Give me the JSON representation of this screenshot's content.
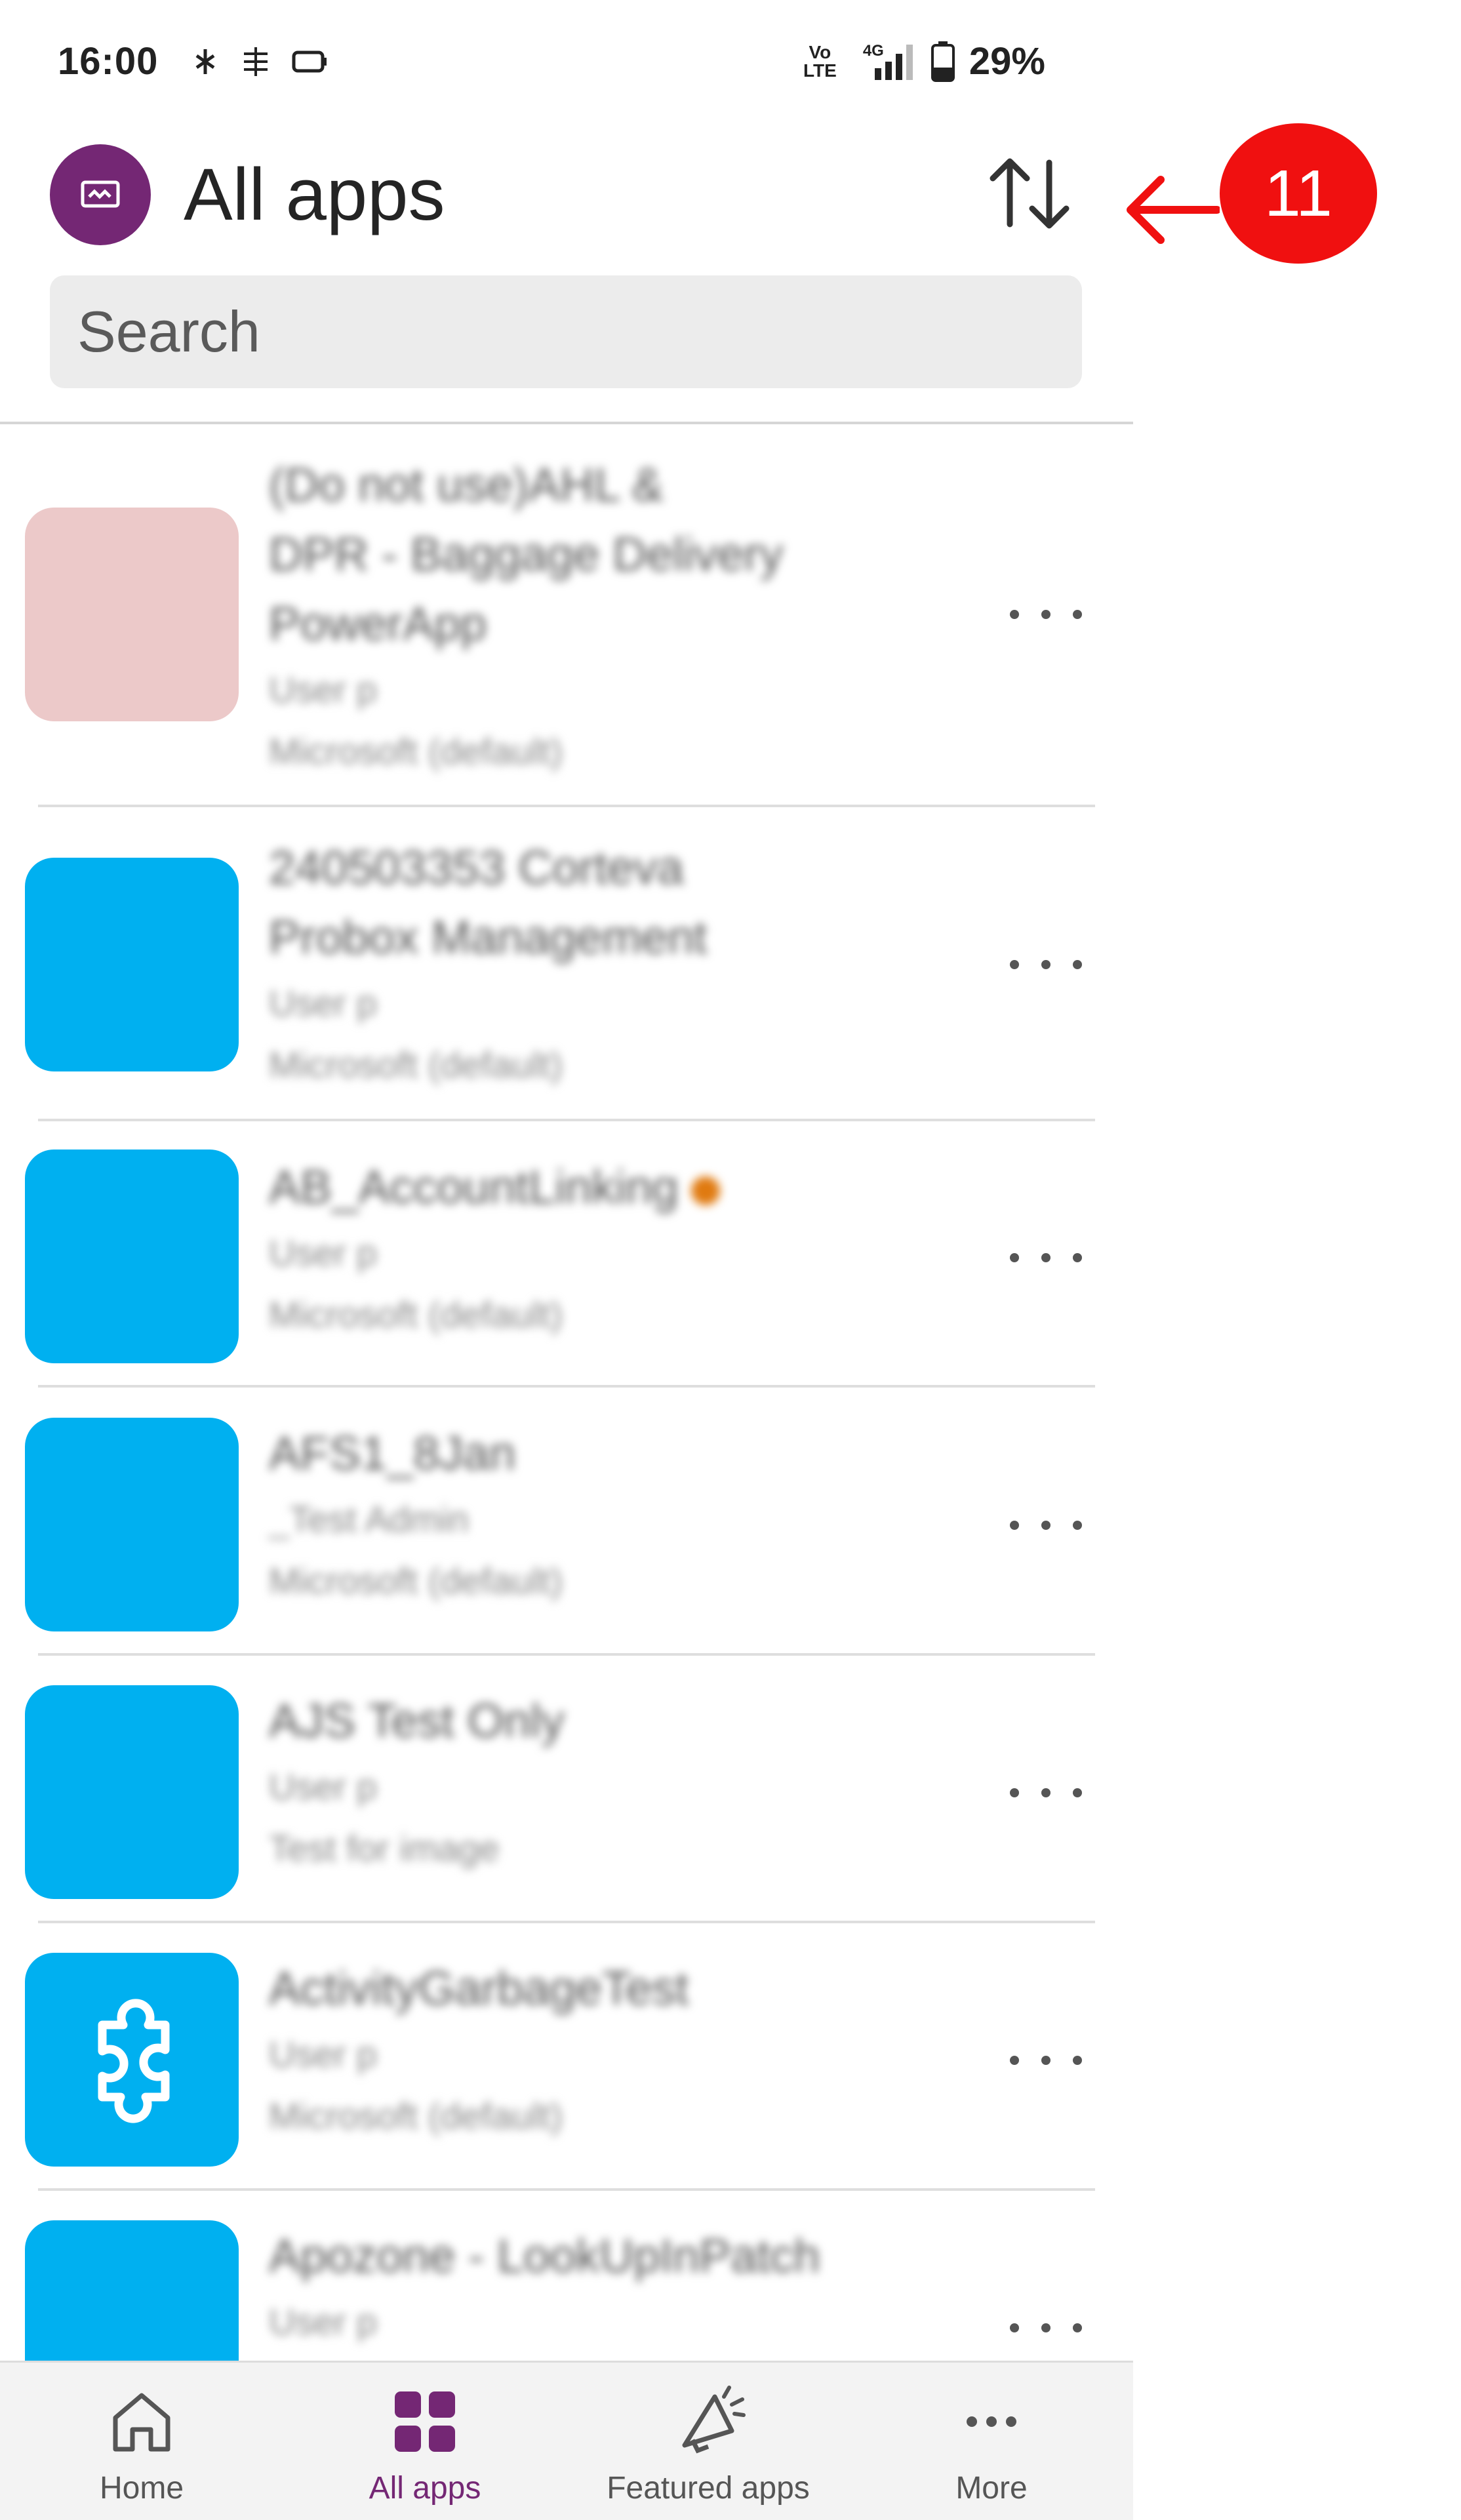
{
  "status_bar": {
    "time": "16:00",
    "network_top": "Vo",
    "network_bottom": "LTE",
    "network_type": "4G",
    "battery": "29%",
    "icons": [
      "bluetooth-like-icon",
      "nfc-icon",
      "cast-icon",
      "signal-icon",
      "battery-icon"
    ]
  },
  "header": {
    "title": "All apps",
    "logo_icon": "power-apps-logo",
    "sort_icon": "sort-arrows-icon"
  },
  "annotation": {
    "number": "11"
  },
  "search": {
    "placeholder": "Search",
    "value": ""
  },
  "apps": [
    {
      "title_lines": [
        "(Do not use)AHL &",
        "DPR - Baggage Delivery",
        "PowerApp"
      ],
      "owner": "User p",
      "environment": "Microsoft (default)",
      "color": "#ecc9c9",
      "icon": ""
    },
    {
      "title_lines": [
        "240503353 Corteva",
        "Probox Management"
      ],
      "owner": "User p",
      "environment": "Microsoft (default)",
      "color": "#00b0f0",
      "icon": ""
    },
    {
      "title_lines": [
        "AB_AccountLinking"
      ],
      "owner": "User p",
      "environment": "Microsoft (default)",
      "color": "#00b0f0",
      "icon": "",
      "favorite": true
    },
    {
      "title_lines": [
        "AFS1_8Jan"
      ],
      "owner": "_Test Admin",
      "environment": "Microsoft (default)",
      "color": "#00b0f0",
      "icon": ""
    },
    {
      "title_lines": [
        "AJS Test Only"
      ],
      "owner": "User p",
      "environment": "Test for image",
      "color": "#00b0f0",
      "icon": ""
    },
    {
      "title_lines": [
        "ActivityGarbageTest"
      ],
      "owner": "User p",
      "environment": "Microsoft (default)",
      "color": "#00b0f0",
      "icon": "puzzle-icon"
    },
    {
      "title_lines": [
        "Apozone - LookUpInPatch"
      ],
      "owner": "User p",
      "environment": "",
      "color": "#00b0f0",
      "icon": ""
    }
  ],
  "bottom_nav": [
    {
      "label": "Home",
      "icon": "home-icon",
      "active": false
    },
    {
      "label": "All apps",
      "icon": "apps-grid-icon",
      "active": true
    },
    {
      "label": "Featured apps",
      "icon": "megaphone-icon",
      "active": false
    },
    {
      "label": "More",
      "icon": "more-dots-icon",
      "active": false
    }
  ],
  "colors": {
    "brand": "#742774",
    "app_tile": "#00b0f0",
    "annotation": "#f01010"
  }
}
